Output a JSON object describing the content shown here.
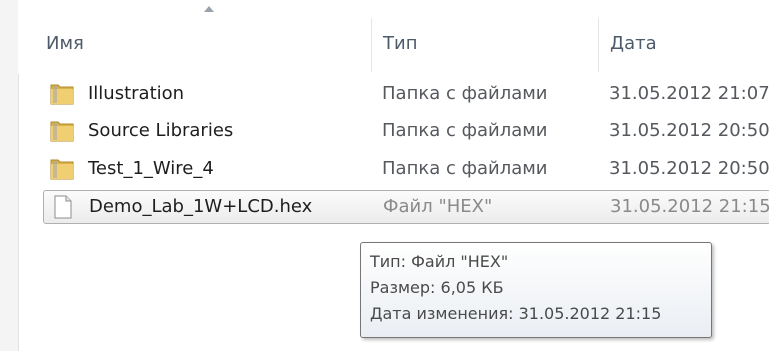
{
  "columns": {
    "name": "Имя",
    "type": "Тип",
    "date": "Дата"
  },
  "files": [
    {
      "name": "Illustration",
      "type": "Папка с файлами",
      "date": "31.05.2012 21:07",
      "icon": "folder-icon"
    },
    {
      "name": "Source Libraries",
      "type": "Папка с файлами",
      "date": "31.05.2012 20:50",
      "icon": "folder-icon"
    },
    {
      "name": "Test_1_Wire_4",
      "type": "Папка с файлами",
      "date": "31.05.2012 20:50",
      "icon": "folder-icon"
    },
    {
      "name": "Demo_Lab_1W+LCD.hex",
      "type": "Файл \"HEX\"",
      "date": "31.05.2012 21:15",
      "icon": "file-icon",
      "selected": true
    }
  ],
  "tooltip": {
    "type_line": "Тип: Файл \"HEX\"",
    "size_line": "Размер: 6,05 КБ",
    "modified_line": "Дата изменения: 31.05.2012 21:15"
  },
  "colors": {
    "folder": "#e8c35a",
    "selection_border": "#b0b0b0",
    "header_text": "#4d5a6a"
  }
}
